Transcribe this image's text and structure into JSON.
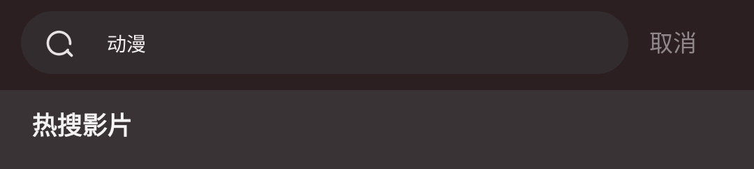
{
  "search": {
    "icon": "search-icon",
    "query": "动漫",
    "cancel_label": "取消"
  },
  "hot_section": {
    "title": "热搜影片"
  },
  "colors": {
    "header_background": "#2b1f22",
    "search_box": "#322c2e",
    "page_background": "#3a3335",
    "cancel_text": "#8f8789",
    "primary_text": "#f2eeef"
  }
}
